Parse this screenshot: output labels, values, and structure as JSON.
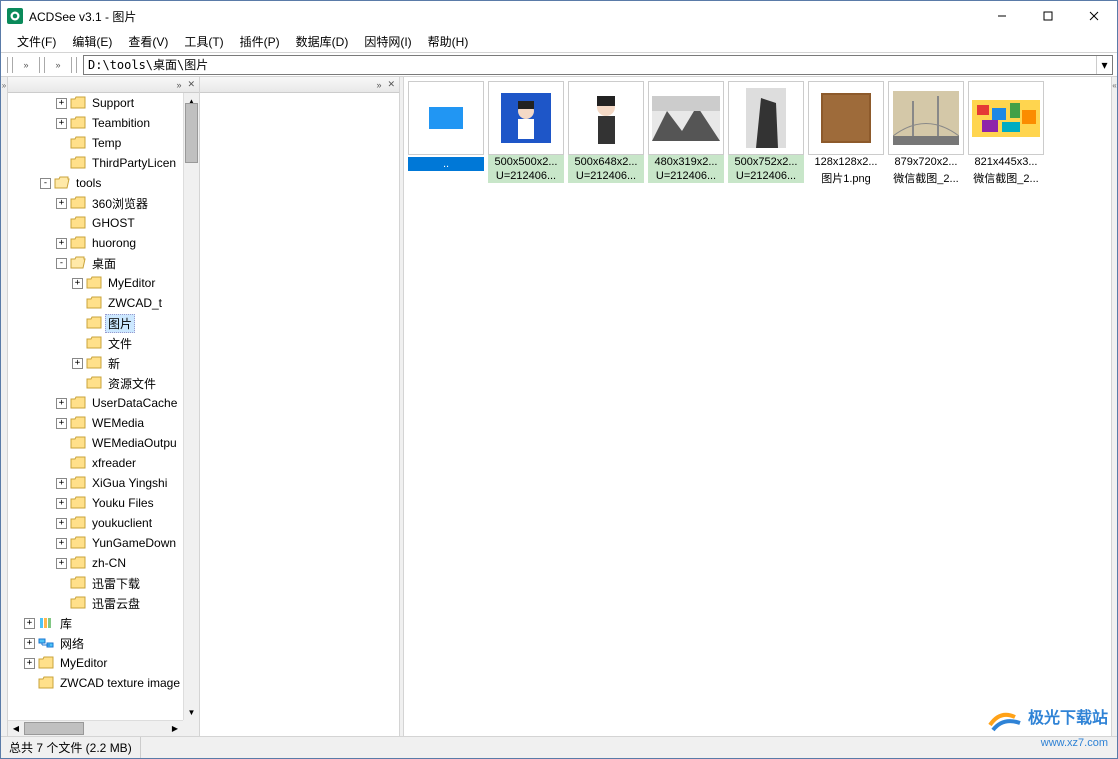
{
  "title": "ACDSee v3.1 - 图片",
  "menu": [
    "文件(F)",
    "编辑(E)",
    "查看(V)",
    "工具(T)",
    "插件(P)",
    "数据库(D)",
    "因特网(I)",
    "帮助(H)"
  ],
  "path": "D:\\tools\\桌面\\图片",
  "tree": [
    {
      "indent": 3,
      "exp": "+",
      "label": "Support",
      "type": "folder"
    },
    {
      "indent": 3,
      "exp": "+",
      "label": "Teambition",
      "type": "folder"
    },
    {
      "indent": 3,
      "exp": "",
      "label": "Temp",
      "type": "folder"
    },
    {
      "indent": 3,
      "exp": "",
      "label": "ThirdPartyLicen",
      "type": "folder"
    },
    {
      "indent": 2,
      "exp": "-",
      "label": "tools",
      "type": "folder-open"
    },
    {
      "indent": 3,
      "exp": "+",
      "label": "360浏览器",
      "type": "folder"
    },
    {
      "indent": 3,
      "exp": "",
      "label": "GHOST",
      "type": "folder"
    },
    {
      "indent": 3,
      "exp": "+",
      "label": "huorong",
      "type": "folder"
    },
    {
      "indent": 3,
      "exp": "-",
      "label": "桌面",
      "type": "folder-open"
    },
    {
      "indent": 4,
      "exp": "+",
      "label": "MyEditor",
      "type": "folder"
    },
    {
      "indent": 4,
      "exp": "",
      "label": "ZWCAD_t",
      "type": "folder"
    },
    {
      "indent": 4,
      "exp": "",
      "label": "图片",
      "type": "folder",
      "selected": true
    },
    {
      "indent": 4,
      "exp": "",
      "label": "文件",
      "type": "folder"
    },
    {
      "indent": 4,
      "exp": "+",
      "label": "新",
      "type": "folder"
    },
    {
      "indent": 4,
      "exp": "",
      "label": "资源文件",
      "type": "folder"
    },
    {
      "indent": 3,
      "exp": "+",
      "label": "UserDataCache",
      "type": "folder"
    },
    {
      "indent": 3,
      "exp": "+",
      "label": "WEMedia",
      "type": "folder"
    },
    {
      "indent": 3,
      "exp": "",
      "label": "WEMediaOutpu",
      "type": "folder"
    },
    {
      "indent": 3,
      "exp": "",
      "label": "xfreader",
      "type": "folder"
    },
    {
      "indent": 3,
      "exp": "+",
      "label": "XiGua Yingshi",
      "type": "folder"
    },
    {
      "indent": 3,
      "exp": "+",
      "label": "Youku Files",
      "type": "folder"
    },
    {
      "indent": 3,
      "exp": "+",
      "label": "youkuclient",
      "type": "folder"
    },
    {
      "indent": 3,
      "exp": "+",
      "label": "YunGameDown",
      "type": "folder"
    },
    {
      "indent": 3,
      "exp": "+",
      "label": "zh-CN",
      "type": "folder"
    },
    {
      "indent": 3,
      "exp": "",
      "label": "迅雷下载",
      "type": "folder"
    },
    {
      "indent": 3,
      "exp": "",
      "label": "迅雷云盘",
      "type": "folder"
    },
    {
      "indent": 1,
      "exp": "+",
      "label": "库",
      "type": "library"
    },
    {
      "indent": 1,
      "exp": "+",
      "label": "网络",
      "type": "network"
    },
    {
      "indent": 1,
      "exp": "+",
      "label": "MyEditor",
      "type": "folder"
    },
    {
      "indent": 1,
      "exp": "",
      "label": "ZWCAD texture image",
      "type": "folder"
    }
  ],
  "thumbs": [
    {
      "dims": "",
      "name": "..",
      "selected": true,
      "kind": "up"
    },
    {
      "dims": "500x500x2...",
      "name": "U=212406...",
      "kind": "portrait-blue",
      "green": true
    },
    {
      "dims": "500x648x2...",
      "name": "U=212406...",
      "kind": "portrait-white",
      "green": true
    },
    {
      "dims": "480x319x2...",
      "name": "U=212406...",
      "kind": "mountain",
      "green": true
    },
    {
      "dims": "500x752x2...",
      "name": "U=212406...",
      "kind": "rock",
      "green": true
    },
    {
      "dims": "128x128x2...",
      "name": "图片1.png",
      "kind": "leather"
    },
    {
      "dims": "879x720x2...",
      "name": "微信截图_2...",
      "kind": "bridge"
    },
    {
      "dims": "821x445x3...",
      "name": "微信截图_2...",
      "kind": "colorful"
    }
  ],
  "status": "总共 7 个文件 (2.2 MB)",
  "watermark": {
    "main": "极光下载站",
    "sub": "www.xz7.com"
  }
}
